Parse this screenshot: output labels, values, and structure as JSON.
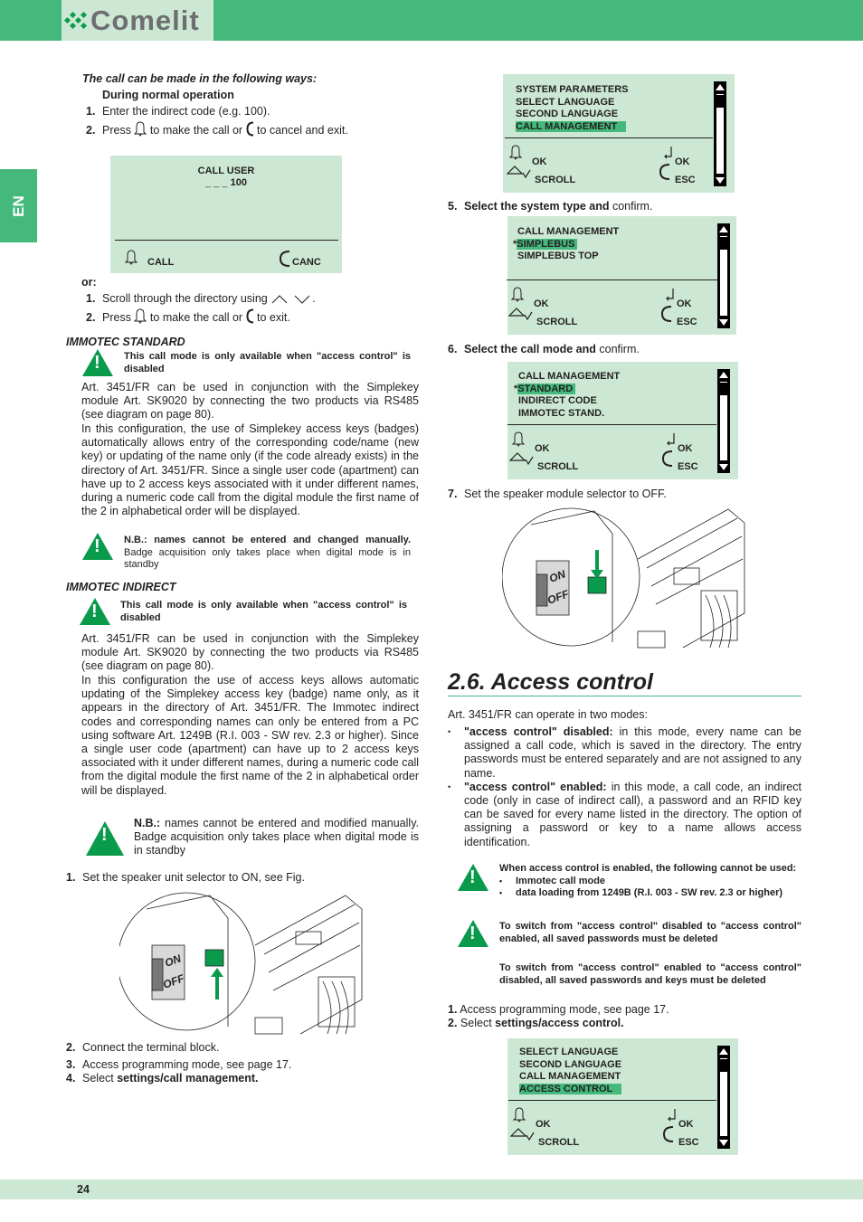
{
  "header": {
    "logo": "Comelit",
    "language_tab": "EN"
  },
  "left": {
    "intro_title": "The call can be made in the following ways:",
    "normal_heading": "During normal operation",
    "steps_a": [
      {
        "n": "1.",
        "text": "Enter the indirect code (e.g. 100)."
      },
      {
        "n": "2.",
        "pre": "Press",
        "mid": "to make the call or",
        "post": "to cancel and exit."
      }
    ],
    "or_label": "or:",
    "steps_b": [
      {
        "n": "1.",
        "text": "Scroll through the directory using"
      },
      {
        "n": "2.",
        "pre": "Press",
        "mid": "to make the call or",
        "post": "to exit."
      }
    ],
    "immotec_standard": {
      "title": "IMMOTEC STANDARD",
      "warning": "This call mode is only available when \"access control\" is disabled",
      "body": "Art. 3451/FR can be used in conjunction with the Simplekey module Art. SK9020 by connecting the two products via RS485 (see diagram on page 80).",
      "body2": "In this configuration, the use of Simplekey access keys (badges) automatically allows entry of the corresponding code/name (new key) or updating of the name only (if the code already exists) in the directory of Art. 3451/FR. Since a single user code (apartment) can have up to 2 access keys associated with it under different names, during a numeric code call from the digital module the first name of the 2 in alphabetical order will be displayed.",
      "nb_bold": "N.B.: names cannot be entered and changed manually.",
      "nb_text": "Badge acquisition only takes place when digital mode is in standby"
    },
    "immotec_indirect": {
      "title": "IMMOTEC INDIRECT",
      "warning": "This call mode is only available when \"access control\" is disabled",
      "body": "Art. 3451/FR can be used in conjunction with the Simplekey module Art. SK9020 by connecting the two products via RS485 (see diagram on page 80).",
      "body2": "In this configuration the use of access keys allows automatic updating of the Simplekey access key (badge) name only, as it appears in the directory of Art. 3451/FR. The Immotec indirect codes and corresponding names can only be entered from a PC using software Art. 1249B (R.I. 003 - SW rev. 2.3 or higher). Since a single user code (apartment) can have up to 2 access keys associated with it under different names, during a numeric code call from the digital module the first name of the 2 in alphabetical order will be displayed.",
      "nb_bold": "N.B.:",
      "nb_text": "names cannot be entered and modified manually. Badge acquisition only takes place when digital mode is in standby"
    },
    "steps_c": [
      {
        "n": "1.",
        "text": "Set the speaker unit selector to ON, see Fig."
      }
    ],
    "steps_d": [
      {
        "n": "2.",
        "text": "Connect the terminal block."
      },
      {
        "n": "3.",
        "text": "Access programming mode, see page 17."
      },
      {
        "n": "4.",
        "pre": "Select",
        "bold": "settings/call management."
      }
    ],
    "fig_on": {
      "on": "ON",
      "off": "OFF"
    }
  },
  "screens": {
    "call_user": {
      "title": "CALL USER",
      "code_prefix": "_ _ _",
      "code": "100",
      "left": "CALL",
      "right": "CANC"
    },
    "s1": {
      "lines": [
        "SYSTEM PARAMETERS",
        "SELECT LANGUAGE",
        "SECOND LANGUAGE",
        "CALL MANAGEMENT"
      ],
      "selected": 3,
      "ok": "OK",
      "scroll": "SCROLL",
      "ok2": "OK",
      "esc": "ESC"
    },
    "s2": {
      "lines": [
        "CALL MANAGEMENT",
        "*SIMPLEBUS",
        "SIMPLEBUS TOP"
      ],
      "selected": 1,
      "ok": "OK",
      "scroll": "SCROLL",
      "ok2": "OK",
      "esc": "ESC"
    },
    "s3": {
      "lines": [
        "CALL MANAGEMENT",
        "*STANDARD",
        "INDIRECT CODE",
        "IMMOTEC STAND."
      ],
      "selected": 1,
      "ok": "OK",
      "scroll": "SCROLL",
      "ok2": "OK",
      "esc": "ESC"
    },
    "s4": {
      "lines": [
        "SELECT LANGUAGE",
        "SECOND LANGUAGE",
        "CALL MANAGEMENT",
        "ACCESS CONTROL"
      ],
      "selected": 3,
      "ok": "OK",
      "scroll": "SCROLL",
      "ok2": "OK",
      "esc": "ESC"
    }
  },
  "right": {
    "step5": {
      "n": "5.",
      "bold": "Select the system type and",
      "text": "confirm."
    },
    "step6": {
      "n": "6.",
      "bold": "Select the call mode and",
      "text": "confirm."
    },
    "step7": {
      "n": "7.",
      "text": "Set the speaker module selector to OFF."
    },
    "section_title": "2.6. Access control",
    "intro": "Art. 3451/FR can operate in two modes:",
    "bullets": [
      {
        "bold": "\"access control\" disabled:",
        "text": " in this mode, every name can be assigned a call code, which is saved in the directory. The entry passwords must be entered separately and are not assigned to any name."
      },
      {
        "bold": "\"access control\" enabled:",
        "text": " in this mode, a call code, an indirect code (only in case of indirect call), a password and an RFID key can be saved for every name listed in the directory. The option of assigning a password or key to a name allows access identification."
      }
    ],
    "warn1": {
      "title": "When access control is enabled, the following cannot be used:",
      "items": [
        "Immotec call mode",
        "data loading from 1249B (R.I. 003 - SW rev. 2.3 or higher)"
      ]
    },
    "warn2": "To switch from \"access control\" disabled to \"access control\" enabled, all saved passwords must be deleted",
    "warn3": "To switch from \"access control\" enabled to \"access control\" disabled, all saved passwords and keys must be deleted",
    "steps": [
      {
        "n": "1.",
        "text": "Access programming mode, see page 17."
      },
      {
        "n": "2.",
        "pre": "Select",
        "bold": "settings/access control."
      }
    ]
  },
  "footer": {
    "page": "24"
  },
  "colors": {
    "brand_green": "#45b97c",
    "light_green": "#cce8d4",
    "warning_green": "#0a9a4c"
  }
}
